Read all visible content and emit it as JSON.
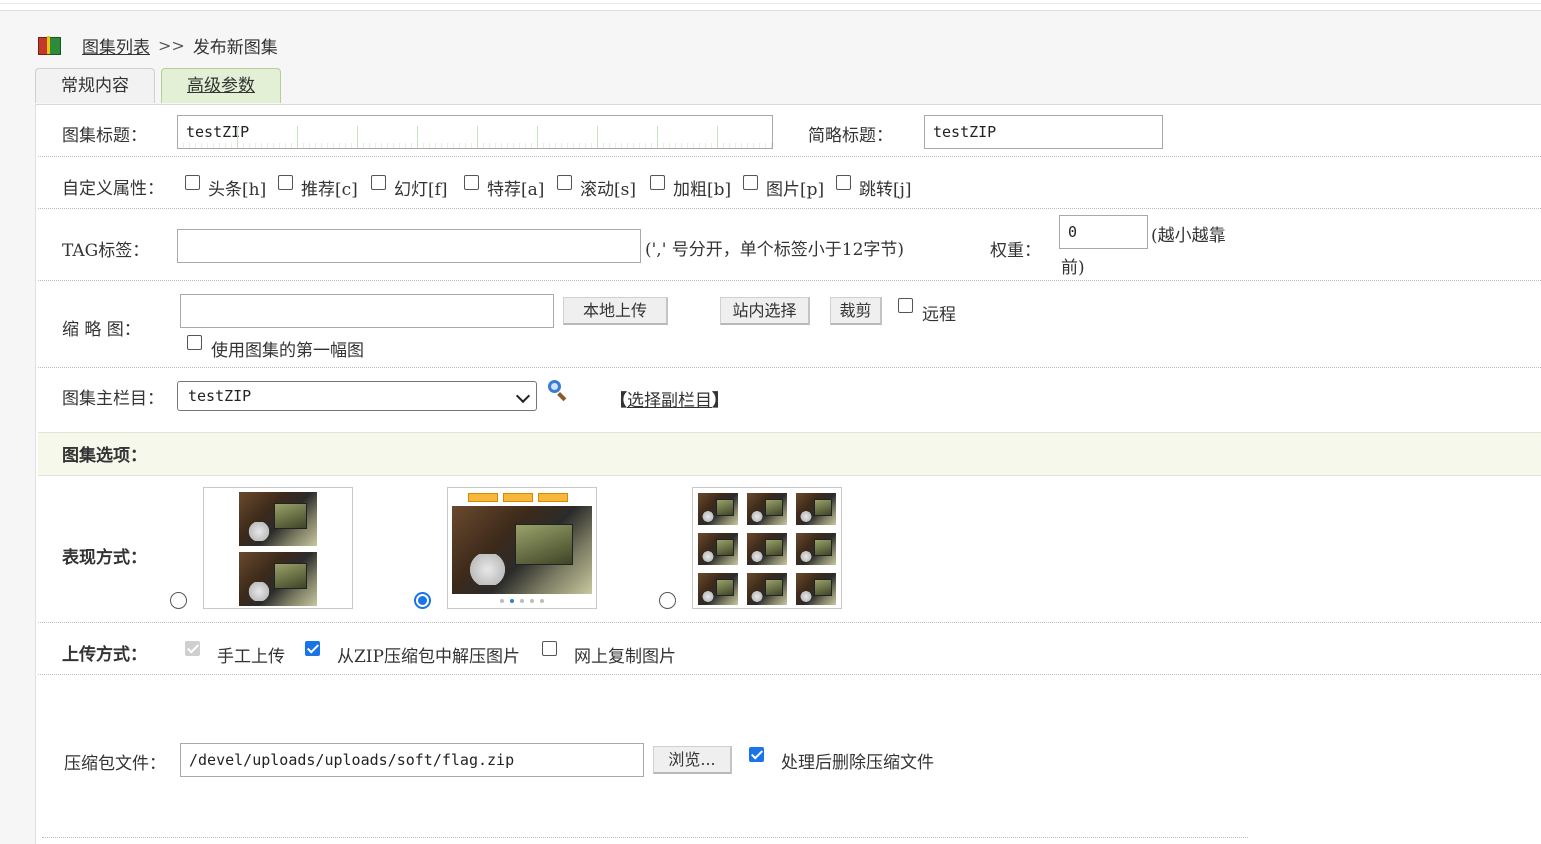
{
  "breadcrumb": {
    "list_link": "图集列表",
    "separator": ">>",
    "current": "发布新图集"
  },
  "tabs": {
    "general": "常规内容",
    "advanced": "高级参数",
    "active": "advanced"
  },
  "title_row": {
    "label": "图集标题：",
    "value": "testZIP",
    "short_label": "简略标题：",
    "short_value": "testZIP"
  },
  "flags": {
    "label": "自定义属性：",
    "items": [
      {
        "label": "头条[h]",
        "checked": false
      },
      {
        "label": "推荐[c]",
        "checked": false
      },
      {
        "label": "幻灯[f]",
        "checked": false
      },
      {
        "label": "特荐[a]",
        "checked": false
      },
      {
        "label": "滚动[s]",
        "checked": false
      },
      {
        "label": "加粗[b]",
        "checked": false
      },
      {
        "label": "图片[p]",
        "checked": false
      },
      {
        "label": "跳转[j]",
        "checked": false
      }
    ]
  },
  "tag_row": {
    "label": "TAG标签：",
    "value": "",
    "hint": "(',' 号分开，单个标签小于12字节)",
    "weight_label": "权重：",
    "weight_value": "0",
    "weight_hint_1": "(越小越靠",
    "weight_hint_2": "前)"
  },
  "thumb_row": {
    "label": "缩 略 图：",
    "value": "",
    "upload_btn": "本地上传",
    "site_btn": "站内选择",
    "crop_btn": "裁剪",
    "remote_label": "远程",
    "remote_checked": false,
    "use_first_label": "使用图集的第一幅图",
    "use_first_checked": false
  },
  "column_row": {
    "label": "图集主栏目：",
    "selected": "testZIP",
    "sub_prefix": "【",
    "sub_link": "选择副栏目",
    "sub_suffix": "】"
  },
  "options_header": "图集选项：",
  "display_row": {
    "label": "表现方式：",
    "selected_index": 1
  },
  "upload_row": {
    "label": "上传方式：",
    "manual": {
      "label": "手工上传",
      "checked": true,
      "disabled": true
    },
    "zip": {
      "label": "从ZIP压缩包中解压图片",
      "checked": true
    },
    "web": {
      "label": "网上复制图片",
      "checked": false
    }
  },
  "zip_row": {
    "label": "压缩包文件：",
    "value": "/devel/uploads/uploads/soft/flag.zip",
    "browse_btn": "浏览...",
    "delete_label": "处理后删除压缩文件",
    "delete_checked": true
  }
}
